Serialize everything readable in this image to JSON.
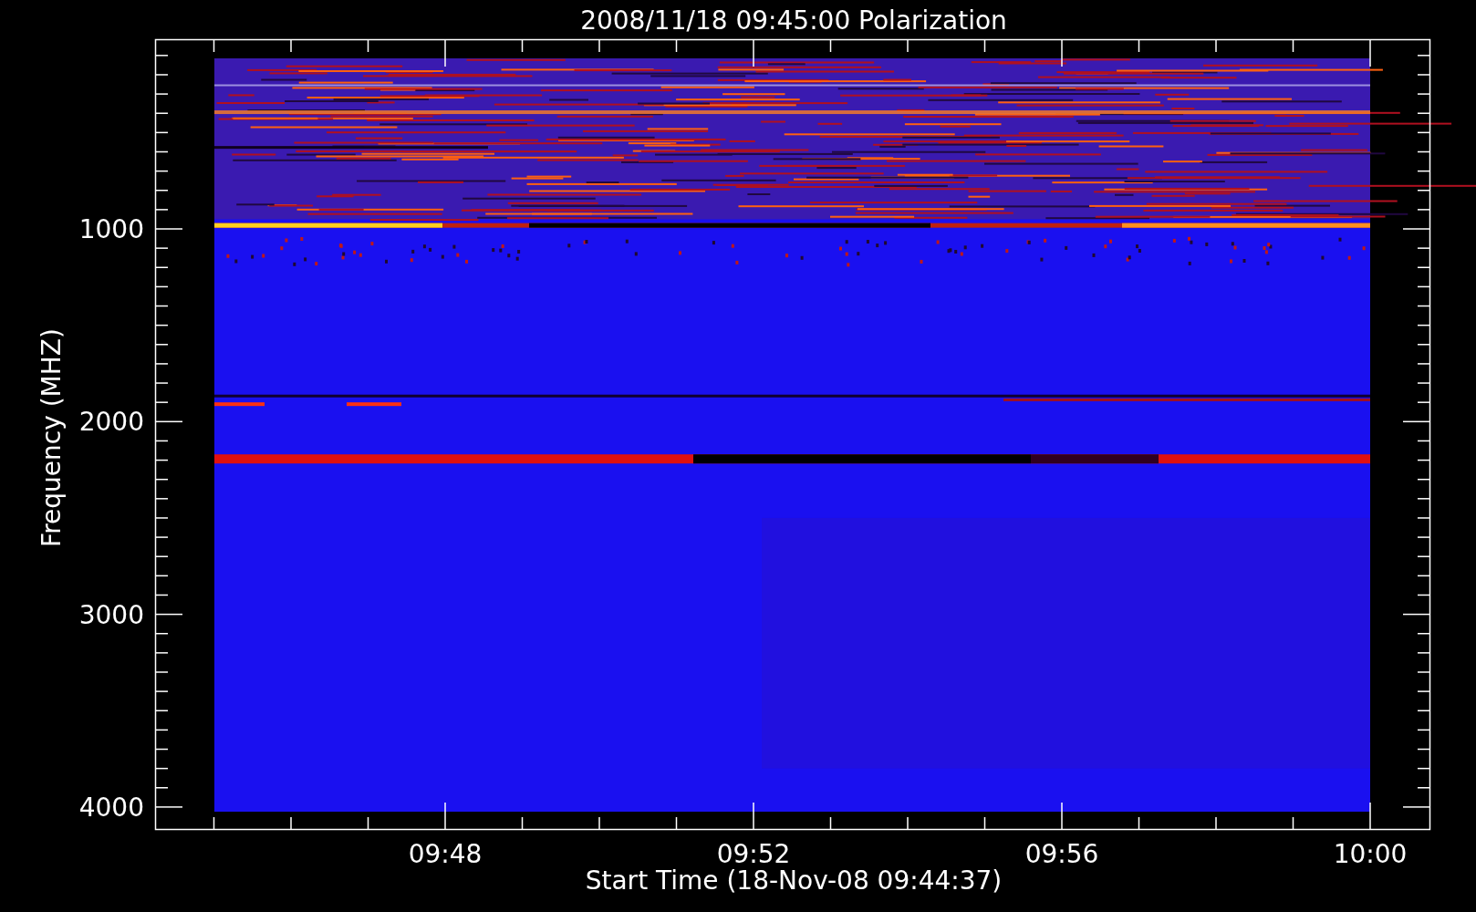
{
  "title": "2008/11/18 09:45:00 Polarization",
  "xlabel": "Start Time (18-Nov-08 09:44:37)",
  "ylabel": "Frequency (MHZ)",
  "x_ticks": [
    "09:48",
    "09:52",
    "09:56",
    "10:00"
  ],
  "y_ticks": [
    "1000",
    "2000",
    "3000",
    "4000"
  ]
}
